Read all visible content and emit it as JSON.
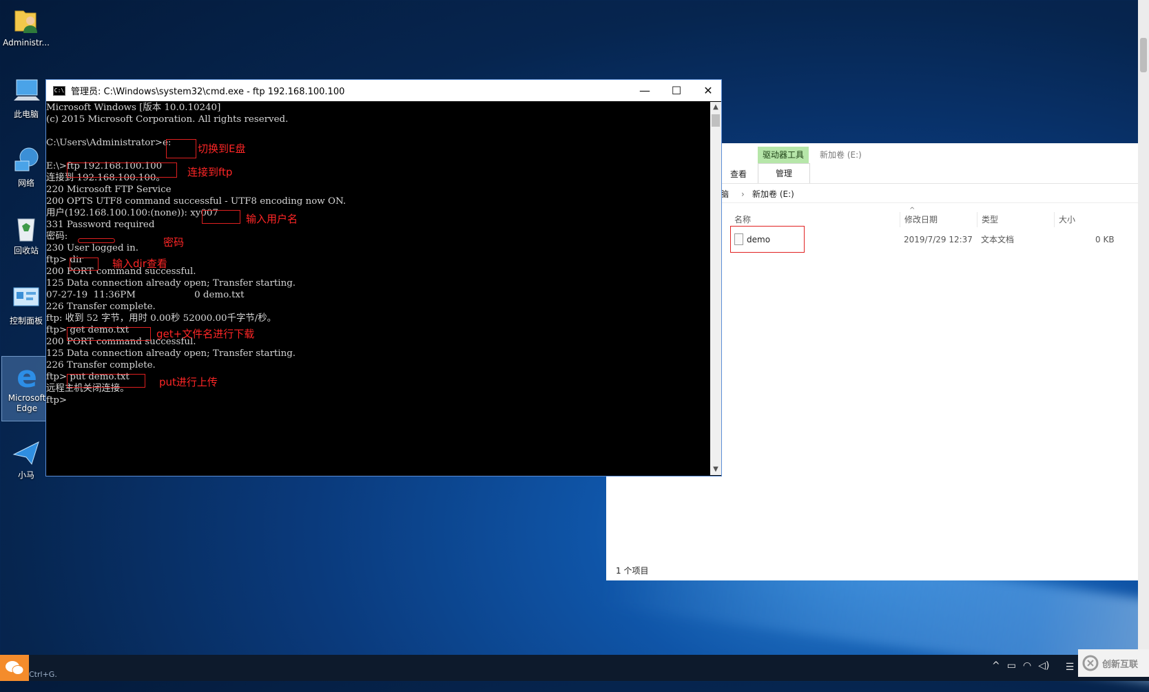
{
  "desktop": {
    "icons": [
      {
        "label": "Administr...",
        "icon": "user-folder-icon"
      },
      {
        "label": "此电脑",
        "icon": "computer-icon"
      },
      {
        "label": "网络",
        "icon": "network-icon"
      },
      {
        "label": "回收站",
        "icon": "recycle-bin-icon"
      },
      {
        "label": "控制面板",
        "icon": "control-panel-icon"
      },
      {
        "label": "Microsoft Edge",
        "icon": "edge-icon"
      },
      {
        "label": "小马",
        "icon": "paper-plane-icon"
      }
    ]
  },
  "cmd": {
    "title": "管理员: C:\\Windows\\system32\\cmd.exe - ftp  192.168.100.100",
    "lines": [
      "Microsoft Windows [版本 10.0.10240]",
      "(c) 2015 Microsoft Corporation. All rights reserved.",
      "",
      "C:\\Users\\Administrator>e:",
      "",
      "E:\\>ftp 192.168.100.100",
      "连接到 192.168.100.100。",
      "220 Microsoft FTP Service",
      "200 OPTS UTF8 command successful - UTF8 encoding now ON.",
      "用户(192.168.100.100:(none)): xy007",
      "331 Password required",
      "密码:",
      "230 User logged in.",
      "ftp> dir",
      "200 PORT command successful.",
      "125 Data connection already open; Transfer starting.",
      "07-27-19  11:36PM                    0 demo.txt",
      "226 Transfer complete.",
      "ftp: 收到 52 字节，用时 0.00秒 52000.00千字节/秒。",
      "ftp> get demo.txt",
      "200 PORT command successful.",
      "125 Data connection already open; Transfer starting.",
      "226 Transfer complete.",
      "ftp> put demo.txt",
      "远程主机关闭连接。",
      "ftp>"
    ],
    "annotations": {
      "switch_drive": "切换到E盘",
      "connect_ftp": "连接到ftp",
      "enter_username": "输入用户名",
      "password": "密码",
      "dir_view": "输入dir查看",
      "get_download": "get+文件名进行下载",
      "put_upload": "put进行上传"
    }
  },
  "explorer": {
    "context_tab_header": "驱动器工具",
    "context_tab": "管理",
    "context_label": "新加卷 (E:)",
    "tab_view": "查看",
    "breadcrumb": [
      "脑",
      "新加卷 (E:)"
    ],
    "columns": [
      "名称",
      "修改日期",
      "类型",
      "大小"
    ],
    "files": [
      {
        "name": "demo",
        "date": "2019/7/29 12:37",
        "type": "文本文档",
        "size": "0 KB"
      }
    ],
    "status": "1 个项目"
  },
  "taskbar": {
    "hint": "Ctrl+G.",
    "watermark": "创新互联"
  }
}
